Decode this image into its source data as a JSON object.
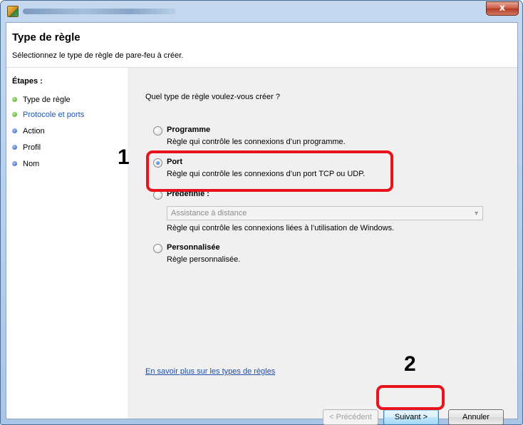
{
  "window": {
    "close_glyph": "x"
  },
  "header": {
    "title": "Type de règle",
    "subtitle": "Sélectionnez le type de règle de pare-feu à créer."
  },
  "steps": {
    "title": "Étapes :",
    "items": [
      {
        "label": "Type de règle",
        "status": "current",
        "dot_color": "#43a321"
      },
      {
        "label": "Protocole et ports",
        "status": "link",
        "dot_color": "#43a321"
      },
      {
        "label": "Action",
        "status": "pending",
        "dot_color": "#2c5fb8"
      },
      {
        "label": "Profil",
        "status": "pending",
        "dot_color": "#2c5fb8"
      },
      {
        "label": "Nom",
        "status": "pending",
        "dot_color": "#2c5fb8"
      }
    ]
  },
  "main": {
    "question": "Quel type de règle voulez-vous créer ?",
    "options": [
      {
        "label": "Programme",
        "desc": "Règle qui contrôle les connexions d’un programme.",
        "checked": false
      },
      {
        "label": "Port",
        "desc": "Règle qui contrôle les connexions d’un port TCP ou UDP.",
        "checked": true
      },
      {
        "label": "Prédéfinie :",
        "desc": "Règle qui contrôle les connexions liées à l’utilisation de Windows.",
        "checked": false
      },
      {
        "label": "Personnalisée",
        "desc": "Règle personnalisée.",
        "checked": false
      }
    ],
    "predefined_select": {
      "value": "Assistance à distance"
    },
    "help_link": "En savoir plus sur les types de règles"
  },
  "buttons": {
    "back": "< Précédent",
    "next": "Suivant >",
    "cancel": "Annuler"
  },
  "annotations": {
    "step1": "1",
    "step2": "2",
    "color": "#e8131b"
  }
}
